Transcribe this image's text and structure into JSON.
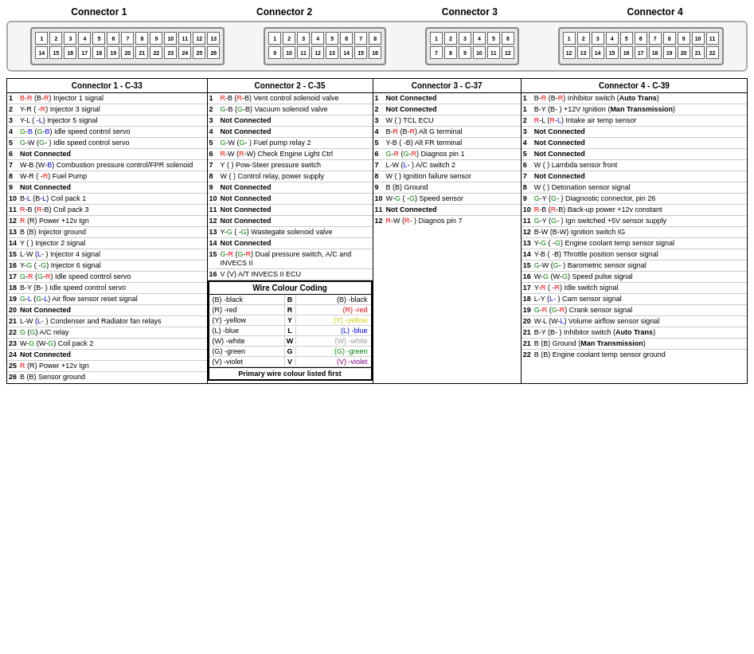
{
  "connectors": {
    "header1": "Connector 1",
    "header2": "Connector 2",
    "header3": "Connector 3",
    "header4": "Connector 4"
  },
  "col1": {
    "header": "Connector 1 - C-33",
    "rows": [
      {
        "num": "1",
        "text": "B-R (B-R) Injector 1 signal"
      },
      {
        "num": "2",
        "text": "Y-R ( -R) Injector 3 signal"
      },
      {
        "num": "3",
        "text": "Y-L ( -L) Injector 5 signal"
      },
      {
        "num": "4",
        "text": "G-B (G-B) Idle speed control servo"
      },
      {
        "num": "5",
        "text": "G-W (G- ) Idle speed control servo"
      },
      {
        "num": "6",
        "text": "Not Connected"
      },
      {
        "num": "7",
        "text": "W-B (W-B) Combustion pressure control/FPR solenoid"
      },
      {
        "num": "8",
        "text": "W-R ( -R) Fuel Pump"
      },
      {
        "num": "9",
        "text": "Not Connected"
      },
      {
        "num": "10",
        "text": "B-L (B-L) Coil pack 1"
      },
      {
        "num": "11",
        "text": "R-B (R-B) Coil pack 3"
      },
      {
        "num": "12",
        "text": "R (R) Power +12v Ign"
      },
      {
        "num": "13",
        "text": "B (B) Injector ground"
      },
      {
        "num": "14",
        "text": "Y ( ) Injector 2 signal"
      },
      {
        "num": "15",
        "text": "L-W (L- ) Injector 4 signal"
      },
      {
        "num": "16",
        "text": "Y-G ( -G) Injector 6 signal"
      },
      {
        "num": "17",
        "text": "G-R (G-R) Idle speed control servo"
      },
      {
        "num": "18",
        "text": "B-Y (B- ) Idle speed control servo"
      },
      {
        "num": "19",
        "text": "G-L (G-L) Air flow sensor reset signal"
      },
      {
        "num": "20",
        "text": "Not Connected"
      },
      {
        "num": "21",
        "text": "L-W (L- ) Condenser and Radiator fan relays"
      },
      {
        "num": "22",
        "text": "G (G) A/C relay"
      },
      {
        "num": "23",
        "text": "W-G (W-G) Coil pack 2"
      },
      {
        "num": "24",
        "text": "Not Connected"
      },
      {
        "num": "25",
        "text": "R (R) Power +12v Ign"
      },
      {
        "num": "26",
        "text": "B (B) Sensor ground"
      }
    ]
  },
  "col2": {
    "header": "Connector 2 - C-35",
    "rows": [
      {
        "num": "1",
        "text": "R-B (R-B) Vent control solenoid valve"
      },
      {
        "num": "2",
        "text": "G-B (G-B) Vacuum solenoid valve"
      },
      {
        "num": "3",
        "text": "Not Connected"
      },
      {
        "num": "4",
        "text": "Not Connected"
      },
      {
        "num": "5",
        "text": "G-W (G- ) Fuel pump relay 2"
      },
      {
        "num": "6",
        "text": "R-W (R-W) Check Engine Light Ctrl"
      },
      {
        "num": "7",
        "text": "Y ( ) Pow-Steer pressure switch"
      },
      {
        "num": "8",
        "text": "W ( ) Control relay, power supply"
      },
      {
        "num": "9",
        "text": "Not Connected"
      },
      {
        "num": "10",
        "text": "Not Connected"
      },
      {
        "num": "11",
        "text": "Not Connected"
      },
      {
        "num": "12",
        "text": "Not Connected"
      },
      {
        "num": "13",
        "text": "Y-G ( -G) Wastegate solenoid valve"
      },
      {
        "num": "14",
        "text": "Not Connected"
      },
      {
        "num": "15",
        "text": "G-R (G-R) Dual pressure switch, A/C and INVECS II"
      },
      {
        "num": "16",
        "text": "V (V) A/T INVECS II ECU"
      }
    ]
  },
  "col3": {
    "header": "Connector 3 - C-37",
    "rows": [
      {
        "num": "1",
        "text": "Not Connected",
        "bold": true
      },
      {
        "num": "2",
        "text": "Not Connected",
        "bold": true
      },
      {
        "num": "3",
        "text": "W ( ) TCL ECU"
      },
      {
        "num": "4",
        "text": "B-R (B-R) Alt G terminal"
      },
      {
        "num": "5",
        "text": "Y-B ( -B) Alt FR terminal"
      },
      {
        "num": "6",
        "text": "G-R (G-R) Diagnos pin 1"
      },
      {
        "num": "7",
        "text": "L-W (L- ) A/C switch 2"
      },
      {
        "num": "8",
        "text": "W ( ) Ignition failure sensor"
      },
      {
        "num": "9",
        "text": "B (B) Ground"
      },
      {
        "num": "10",
        "text": "W-G ( -G) Speed sensor"
      },
      {
        "num": "11",
        "text": "Not Connected",
        "bold": true
      },
      {
        "num": "12",
        "text": "R-W (R- ) Diagnos pin 7"
      }
    ]
  },
  "col4": {
    "header": "Connector 4 - C-39",
    "rows": [
      {
        "num": "1",
        "text": "B-R (B-R) Inhibitor switch (Auto Trans)"
      },
      {
        "num": "1",
        "text": "B-Y (B- ) +12V Ignition (Man Transmission)"
      },
      {
        "num": "2",
        "text": "R-L (R-L) Intake air temp sensor"
      },
      {
        "num": "3",
        "text": "Not Connected",
        "bold": true
      },
      {
        "num": "4",
        "text": "Not Connected",
        "bold": true
      },
      {
        "num": "5",
        "text": "Not Connected",
        "bold": true
      },
      {
        "num": "6",
        "text": "W ( ) Lambda sensor front"
      },
      {
        "num": "7",
        "text": "Not Connected",
        "bold": true
      },
      {
        "num": "8",
        "text": "W ( ) Detonation sensor signal"
      },
      {
        "num": "9",
        "text": "G-Y (G- ) Diagnostic connector, pin 26"
      },
      {
        "num": "10",
        "text": "R-B (R-B) Back-up power +12v constant"
      },
      {
        "num": "11",
        "text": "G-Y (G- ) Ign switched +5V sensor supply"
      },
      {
        "num": "12",
        "text": "B-W (B-W) Ignition switch IG"
      },
      {
        "num": "13",
        "text": "Y-G ( -G) Engine coolant temp sensor signal"
      },
      {
        "num": "14",
        "text": "Y-B ( -B) Throttle position sensor signal"
      },
      {
        "num": "15",
        "text": "G-W (G- ) Barometric sensor signal"
      },
      {
        "num": "16",
        "text": "W-G (W-G) Speed pulse signal"
      },
      {
        "num": "17",
        "text": "Y-R ( -R) Idle switch signal"
      },
      {
        "num": "18",
        "text": "L-Y (L- ) Cam sensor signal"
      },
      {
        "num": "19",
        "text": "G-R (G-R) Crank sensor signal"
      },
      {
        "num": "20",
        "text": "W-L (W-L) Volume airflow sensor signal"
      },
      {
        "num": "21",
        "text": "B-Y (B- ) Inhibitor switch (Auto Trans)"
      },
      {
        "num": "21",
        "text": "B (B) Ground (Man Transmission)"
      },
      {
        "num": "22",
        "text": "B (B) Engine coolant temp sensor ground"
      }
    ]
  },
  "wcc": {
    "title": "Wire Colour Coding",
    "rows": [
      {
        "left": "(B) -black",
        "mid": "B",
        "right": "(B) -black",
        "right_color": "black"
      },
      {
        "left": "(R) -red",
        "mid": "R",
        "right": "(R) -red",
        "right_color": "red"
      },
      {
        "left": "(Y) -yellow",
        "mid": "Y",
        "right": "(Y) -yellow",
        "right_color": "yellow"
      },
      {
        "left": "(L) -blue",
        "mid": "L",
        "right": "(L) -blue",
        "right_color": "blue"
      },
      {
        "left": "(W) -white",
        "mid": "W",
        "right": "(W) -white",
        "right_color": "gray"
      },
      {
        "left": "(G) -green",
        "mid": "G",
        "right": "(G) -green",
        "right_color": "green"
      },
      {
        "left": "(V) -violet",
        "mid": "V",
        "right": "(V) -violet",
        "right_color": "purple"
      }
    ],
    "footer": "Primary wire colour listed first"
  }
}
